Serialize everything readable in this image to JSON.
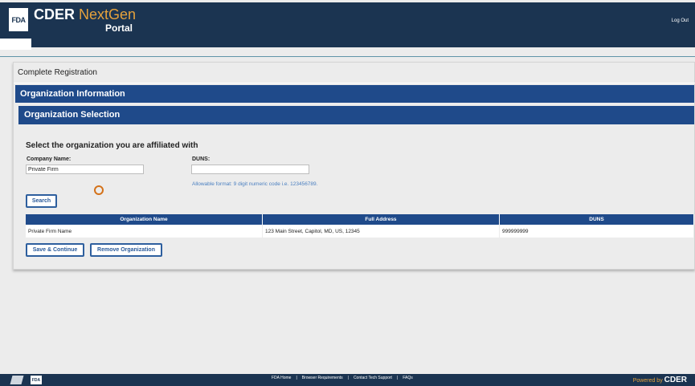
{
  "header": {
    "logo_text": "FDA",
    "brand_main": "CDER",
    "brand_accent": "NextGen",
    "brand_sub": "Portal",
    "logout": "Log Out"
  },
  "page": {
    "title": "Complete Registration",
    "section1": "Organization Information",
    "section2": "Organization Selection"
  },
  "form": {
    "heading": "Select the organization you are affiliated with",
    "company_label": "Company Name:",
    "company_value": "Private Firm",
    "duns_label": "DUNS:",
    "duns_value": "",
    "duns_hint": "Allowable format: 9 digit numeric code i.e. 123456789.",
    "search_label": "Search"
  },
  "table": {
    "columns": [
      "Organization Name",
      "Full Address",
      "DUNS"
    ],
    "rows": [
      [
        "Private Firm Name",
        "123 Main Street, Capitol, MD, US, 12345",
        "999999999"
      ]
    ]
  },
  "actions": {
    "save_label": "Save & Continue",
    "remove_label": "Remove Organization"
  },
  "footer": {
    "icon_text": "FDA",
    "links": [
      "FDA Home",
      "Browser Requirements",
      "Contact Tech Support",
      "FAQs"
    ],
    "separator": "|",
    "powered_by": "Powered by",
    "powered_brand": "CDER"
  },
  "colors": {
    "header_bg": "#1b3451",
    "section_bar": "#1f4a8a",
    "accent_orange": "#e6a23c",
    "button_border": "#2e5f9e"
  }
}
